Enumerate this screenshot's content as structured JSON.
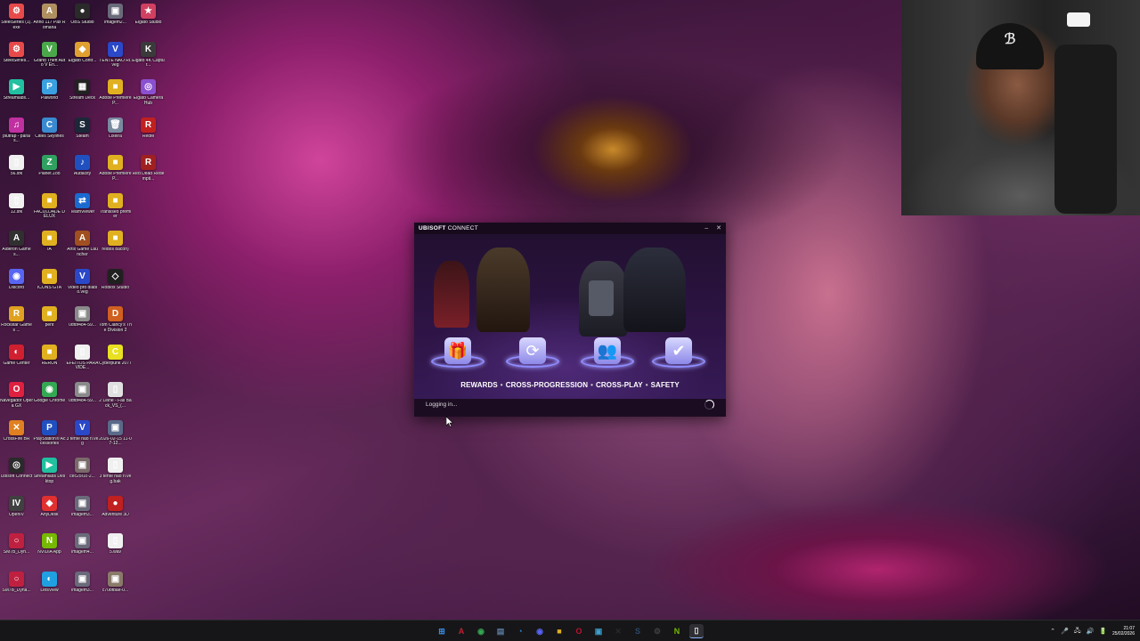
{
  "desktop": {
    "icons": [
      {
        "label": "SteelSeries (1).exe",
        "glyph": "⚙",
        "color": "#e84a4a"
      },
      {
        "label": "Anno 117 Pax Romana",
        "glyph": "A",
        "color": "#b09060"
      },
      {
        "label": "OBS Studio",
        "glyph": "●",
        "color": "#2a2a2a"
      },
      {
        "label": "imagem2...",
        "glyph": "▣",
        "color": "#6a6a7a"
      },
      {
        "label": "Elgato Studio",
        "glyph": "★",
        "color": "#d04060"
      },
      {
        "label": "SteelSeries...",
        "glyph": "⚙",
        "color": "#e84a4a"
      },
      {
        "label": "Grand Theft Auto V En...",
        "glyph": "V",
        "color": "#4aa84a"
      },
      {
        "label": "Elgato Contr...",
        "glyph": "◆",
        "color": "#e0a030"
      },
      {
        "label": "TENTE NAO RI.veg",
        "glyph": "V",
        "color": "#2a48c8"
      },
      {
        "label": "Elgato 4K Captur...",
        "glyph": "K",
        "color": "#3a3a3a"
      },
      {
        "label": "Streamlabs...",
        "glyph": "▶",
        "color": "#20c0a0"
      },
      {
        "label": "Palworld",
        "glyph": "P",
        "color": "#3aa0e0"
      },
      {
        "label": "Stream Deck",
        "glyph": "▦",
        "color": "#222"
      },
      {
        "label": "Adobe Premiere P...",
        "glyph": "■",
        "color": "#e0b020"
      },
      {
        "label": "Elgato Camera Hub",
        "glyph": "◎",
        "color": "#8a50d0"
      },
      {
        "label": "piutrap - parais...",
        "glyph": "♫",
        "color": "#c030a0"
      },
      {
        "label": "Cities Skylines",
        "glyph": "C",
        "color": "#3a8ad0"
      },
      {
        "label": "Steam",
        "glyph": "S",
        "color": "#1b2838"
      },
      {
        "label": "Lixeira",
        "glyph": "🗑",
        "color": "#7a8aa0"
      },
      {
        "label": "RedM",
        "glyph": "R",
        "color": "#c02020"
      },
      {
        "label": "56.sfk",
        "glyph": "▯",
        "color": "#f0f0f0"
      },
      {
        "label": "Planet Zoo",
        "glyph": "Z",
        "color": "#30a060"
      },
      {
        "label": "Audacity",
        "glyph": "♪",
        "color": "#2050c0"
      },
      {
        "label": "Adobe Premiere P...",
        "glyph": "■",
        "color": "#e0b020"
      },
      {
        "label": "Red Dead Redempti...",
        "glyph": "R",
        "color": "#a02020"
      },
      {
        "label": "12.sfk",
        "glyph": "▯",
        "color": "#f0f0f0"
      },
      {
        "label": "FACULDADE DELUX",
        "glyph": "■",
        "color": "#e0b020"
      },
      {
        "label": "TeamViewer",
        "glyph": "⇄",
        "color": "#1a6ad0"
      },
      {
        "label": "Transiseo premier",
        "glyph": "■",
        "color": "#e0b020"
      },
      {
        "label": "",
        "glyph": "",
        "color": "transparent"
      },
      {
        "label": "Alderon Games...",
        "glyph": "A",
        "color": "#303030"
      },
      {
        "label": "IA",
        "glyph": "■",
        "color": "#e0b020"
      },
      {
        "label": "Artix Game Launcher",
        "glyph": "A",
        "color": "#a05020"
      },
      {
        "label": "reidos bacon)",
        "glyph": "■",
        "color": "#e0b020"
      },
      {
        "label": "",
        "glyph": "",
        "color": "transparent"
      },
      {
        "label": "Discord",
        "glyph": "◉",
        "color": "#5865f2"
      },
      {
        "label": "ICONS GTA",
        "glyph": "■",
        "color": "#e0b020"
      },
      {
        "label": "Video pro diablo.veg",
        "glyph": "V",
        "color": "#2a48c8"
      },
      {
        "label": "Roblox Studio",
        "glyph": "◇",
        "color": "#202020"
      },
      {
        "label": "",
        "glyph": "",
        "color": "transparent"
      },
      {
        "label": "Rockstar Games ...",
        "glyph": "R",
        "color": "#e0a020"
      },
      {
        "label": "pent",
        "glyph": "■",
        "color": "#e0b020"
      },
      {
        "label": "0df8f484-59...",
        "glyph": "▣",
        "color": "#8a8a8a"
      },
      {
        "label": "Tom Clancy's The Division 2",
        "glyph": "D",
        "color": "#d06020"
      },
      {
        "label": "",
        "glyph": "",
        "color": "transparent"
      },
      {
        "label": "Game Center",
        "glyph": "◐",
        "color": "#d02030"
      },
      {
        "label": "RERUN",
        "glyph": "■",
        "color": "#e0b020"
      },
      {
        "label": "EFEITOS PARA VIDE...",
        "glyph": "▯",
        "color": "#f0f0f0"
      },
      {
        "label": "Cyberpunk 2077",
        "glyph": "C",
        "color": "#e8e020"
      },
      {
        "label": "",
        "glyph": "",
        "color": "transparent"
      },
      {
        "label": "Navegador Opera GX",
        "glyph": "O",
        "color": "#e02040"
      },
      {
        "label": "Google Chrome",
        "glyph": "◉",
        "color": "#34a853"
      },
      {
        "label": "0df8f484-59...",
        "glyph": "▣",
        "color": "#8a8a8a"
      },
      {
        "label": "2 Lelne - Fall Back_VS_(...",
        "glyph": "▯",
        "color": "#e0e0e0"
      },
      {
        "label": "",
        "glyph": "",
        "color": "transparent"
      },
      {
        "label": "CrossFire BR",
        "glyph": "✕",
        "color": "#e08020"
      },
      {
        "label": "PlayStation® Accessories",
        "glyph": "P",
        "color": "#2050c0"
      },
      {
        "label": "3 tente nao ri.veg",
        "glyph": "V",
        "color": "#2a48c8"
      },
      {
        "label": "2026-02-15 11-07-12...",
        "glyph": "▣",
        "color": "#5a6a8a"
      },
      {
        "label": "",
        "glyph": "",
        "color": "transparent"
      },
      {
        "label": "Ubisoft Connect",
        "glyph": "◎",
        "color": "#2a2a2a"
      },
      {
        "label": "Streamlabs Desktop",
        "glyph": "▶",
        "color": "#20c0a0"
      },
      {
        "label": "cec25f1c-2...",
        "glyph": "▣",
        "color": "#7a6a6a"
      },
      {
        "label": "3 tente nao ri.veg.bak",
        "glyph": "▯",
        "color": "#f0f0f0"
      },
      {
        "label": "",
        "glyph": "",
        "color": "transparent"
      },
      {
        "label": "OpenIV",
        "glyph": "IV",
        "color": "#404040"
      },
      {
        "label": "AnyDesk",
        "glyph": "◆",
        "color": "#e03030"
      },
      {
        "label": "imagem3...",
        "glyph": "▣",
        "color": "#6a6a7a"
      },
      {
        "label": "Adventure 3D",
        "glyph": "●",
        "color": "#c02020"
      },
      {
        "label": "",
        "glyph": "",
        "color": "transparent"
      },
      {
        "label": "SM7B_Dyn...",
        "glyph": "○",
        "color": "#c02040"
      },
      {
        "label": "NVIDIA App",
        "glyph": "N",
        "color": "#76b900"
      },
      {
        "label": "imagem4...",
        "glyph": "▣",
        "color": "#6a6a7a"
      },
      {
        "label": "5.wav",
        "glyph": "▯",
        "color": "#f0f0f0"
      },
      {
        "label": "",
        "glyph": "",
        "color": "transparent"
      },
      {
        "label": "SM7B_Dyna...",
        "glyph": "○",
        "color": "#c02040"
      },
      {
        "label": "LetsView",
        "glyph": "◐",
        "color": "#20a0e0"
      },
      {
        "label": "imagem3...",
        "glyph": "▣",
        "color": "#6a6a7a"
      },
      {
        "label": "c70bfbae-0...",
        "glyph": "▣",
        "color": "#8a7a6a"
      },
      {
        "label": "",
        "glyph": "",
        "color": "transparent"
      }
    ]
  },
  "ubisoft_window": {
    "title_bold": "UBISOFT",
    "title_rest": " CONNECT",
    "minimize_label": "–",
    "close_label": "✕",
    "features": [
      {
        "label": "REWARDS",
        "icon": "gift-icon",
        "glyph": "🎁"
      },
      {
        "label": "CROSS-PROGRESSION",
        "icon": "sync-icon",
        "glyph": "⟳"
      },
      {
        "label": "CROSS-PLAY",
        "icon": "users-icon",
        "glyph": "👥"
      },
      {
        "label": "SAFETY",
        "icon": "shield-check-icon",
        "glyph": "✔"
      }
    ],
    "separator": "•",
    "status": "Logging in..."
  },
  "taskbar": {
    "apps": [
      {
        "name": "start-button",
        "glyph": "⊞",
        "color": "#3a8ee6"
      },
      {
        "name": "app-a",
        "glyph": "A",
        "color": "#c02030"
      },
      {
        "name": "chrome",
        "glyph": "◉",
        "color": "#34a853"
      },
      {
        "name": "explorer-files",
        "glyph": "▤",
        "color": "#5a7aa0"
      },
      {
        "name": "edge",
        "glyph": "◔",
        "color": "#2a8ad0"
      },
      {
        "name": "discord",
        "glyph": "◉",
        "color": "#5865f2"
      },
      {
        "name": "folder",
        "glyph": "■",
        "color": "#e0b020"
      },
      {
        "name": "opera",
        "glyph": "O",
        "color": "#c01030"
      },
      {
        "name": "photos",
        "glyph": "▣",
        "color": "#3aa0d0"
      },
      {
        "name": "xbox",
        "glyph": "✕",
        "color": "#2a2a2a"
      },
      {
        "name": "steam",
        "glyph": "S",
        "color": "#2a4a6a"
      },
      {
        "name": "settings",
        "glyph": "⚙",
        "color": "#404040"
      },
      {
        "name": "nvidia",
        "glyph": "N",
        "color": "#76b900"
      },
      {
        "name": "ubisoft",
        "glyph": "▯",
        "color": "#e8e8e8"
      }
    ],
    "tray": {
      "chevron": "⌃",
      "icons": [
        "🎤",
        "🖧",
        "🔊",
        "🔋"
      ],
      "time": "21:07",
      "date": "25/02/2026"
    }
  }
}
